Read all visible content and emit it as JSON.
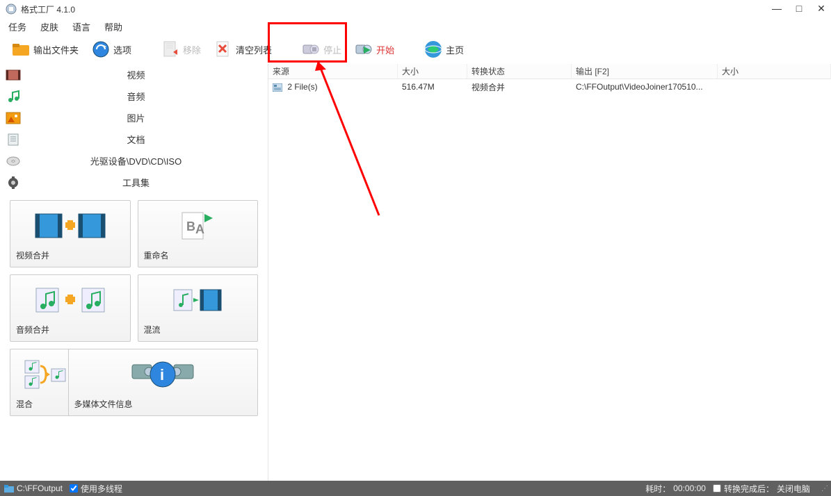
{
  "window": {
    "title": "格式工厂 4.1.0"
  },
  "menu": {
    "task": "任务",
    "skin": "皮肤",
    "language": "语言",
    "help": "帮助"
  },
  "toolbar": {
    "output_folder": "输出文件夹",
    "options": "选项",
    "remove": "移除",
    "clear_list": "清空列表",
    "stop": "停止",
    "start": "开始",
    "home": "主页"
  },
  "categories": {
    "video": "视频",
    "audio": "音频",
    "image": "图片",
    "document": "文档",
    "optical": "光驱设备\\DVD\\CD\\ISO",
    "tools": "工具集"
  },
  "tools": {
    "video_join": "视频合并",
    "rename": "重命名",
    "audio_join": "音频合并",
    "mux": "混流",
    "mix": "混合",
    "media_info": "多媒体文件信息"
  },
  "table": {
    "headers": {
      "source": "来源",
      "size": "大小",
      "status": "转换状态",
      "output": "输出 [F2]",
      "size2": "大小"
    },
    "rows": [
      {
        "source": "2 File(s)",
        "size": "516.47M",
        "status": "视频合并",
        "output": "C:\\FFOutput\\VideoJoiner170510...",
        "size2": ""
      }
    ]
  },
  "status": {
    "output_path": "C:\\FFOutput",
    "multithread": "使用多线程",
    "elapsed_label": "耗时：",
    "elapsed_value": "00:00:00",
    "after_label": "转换完成后：",
    "after_value": "关闭电脑"
  }
}
